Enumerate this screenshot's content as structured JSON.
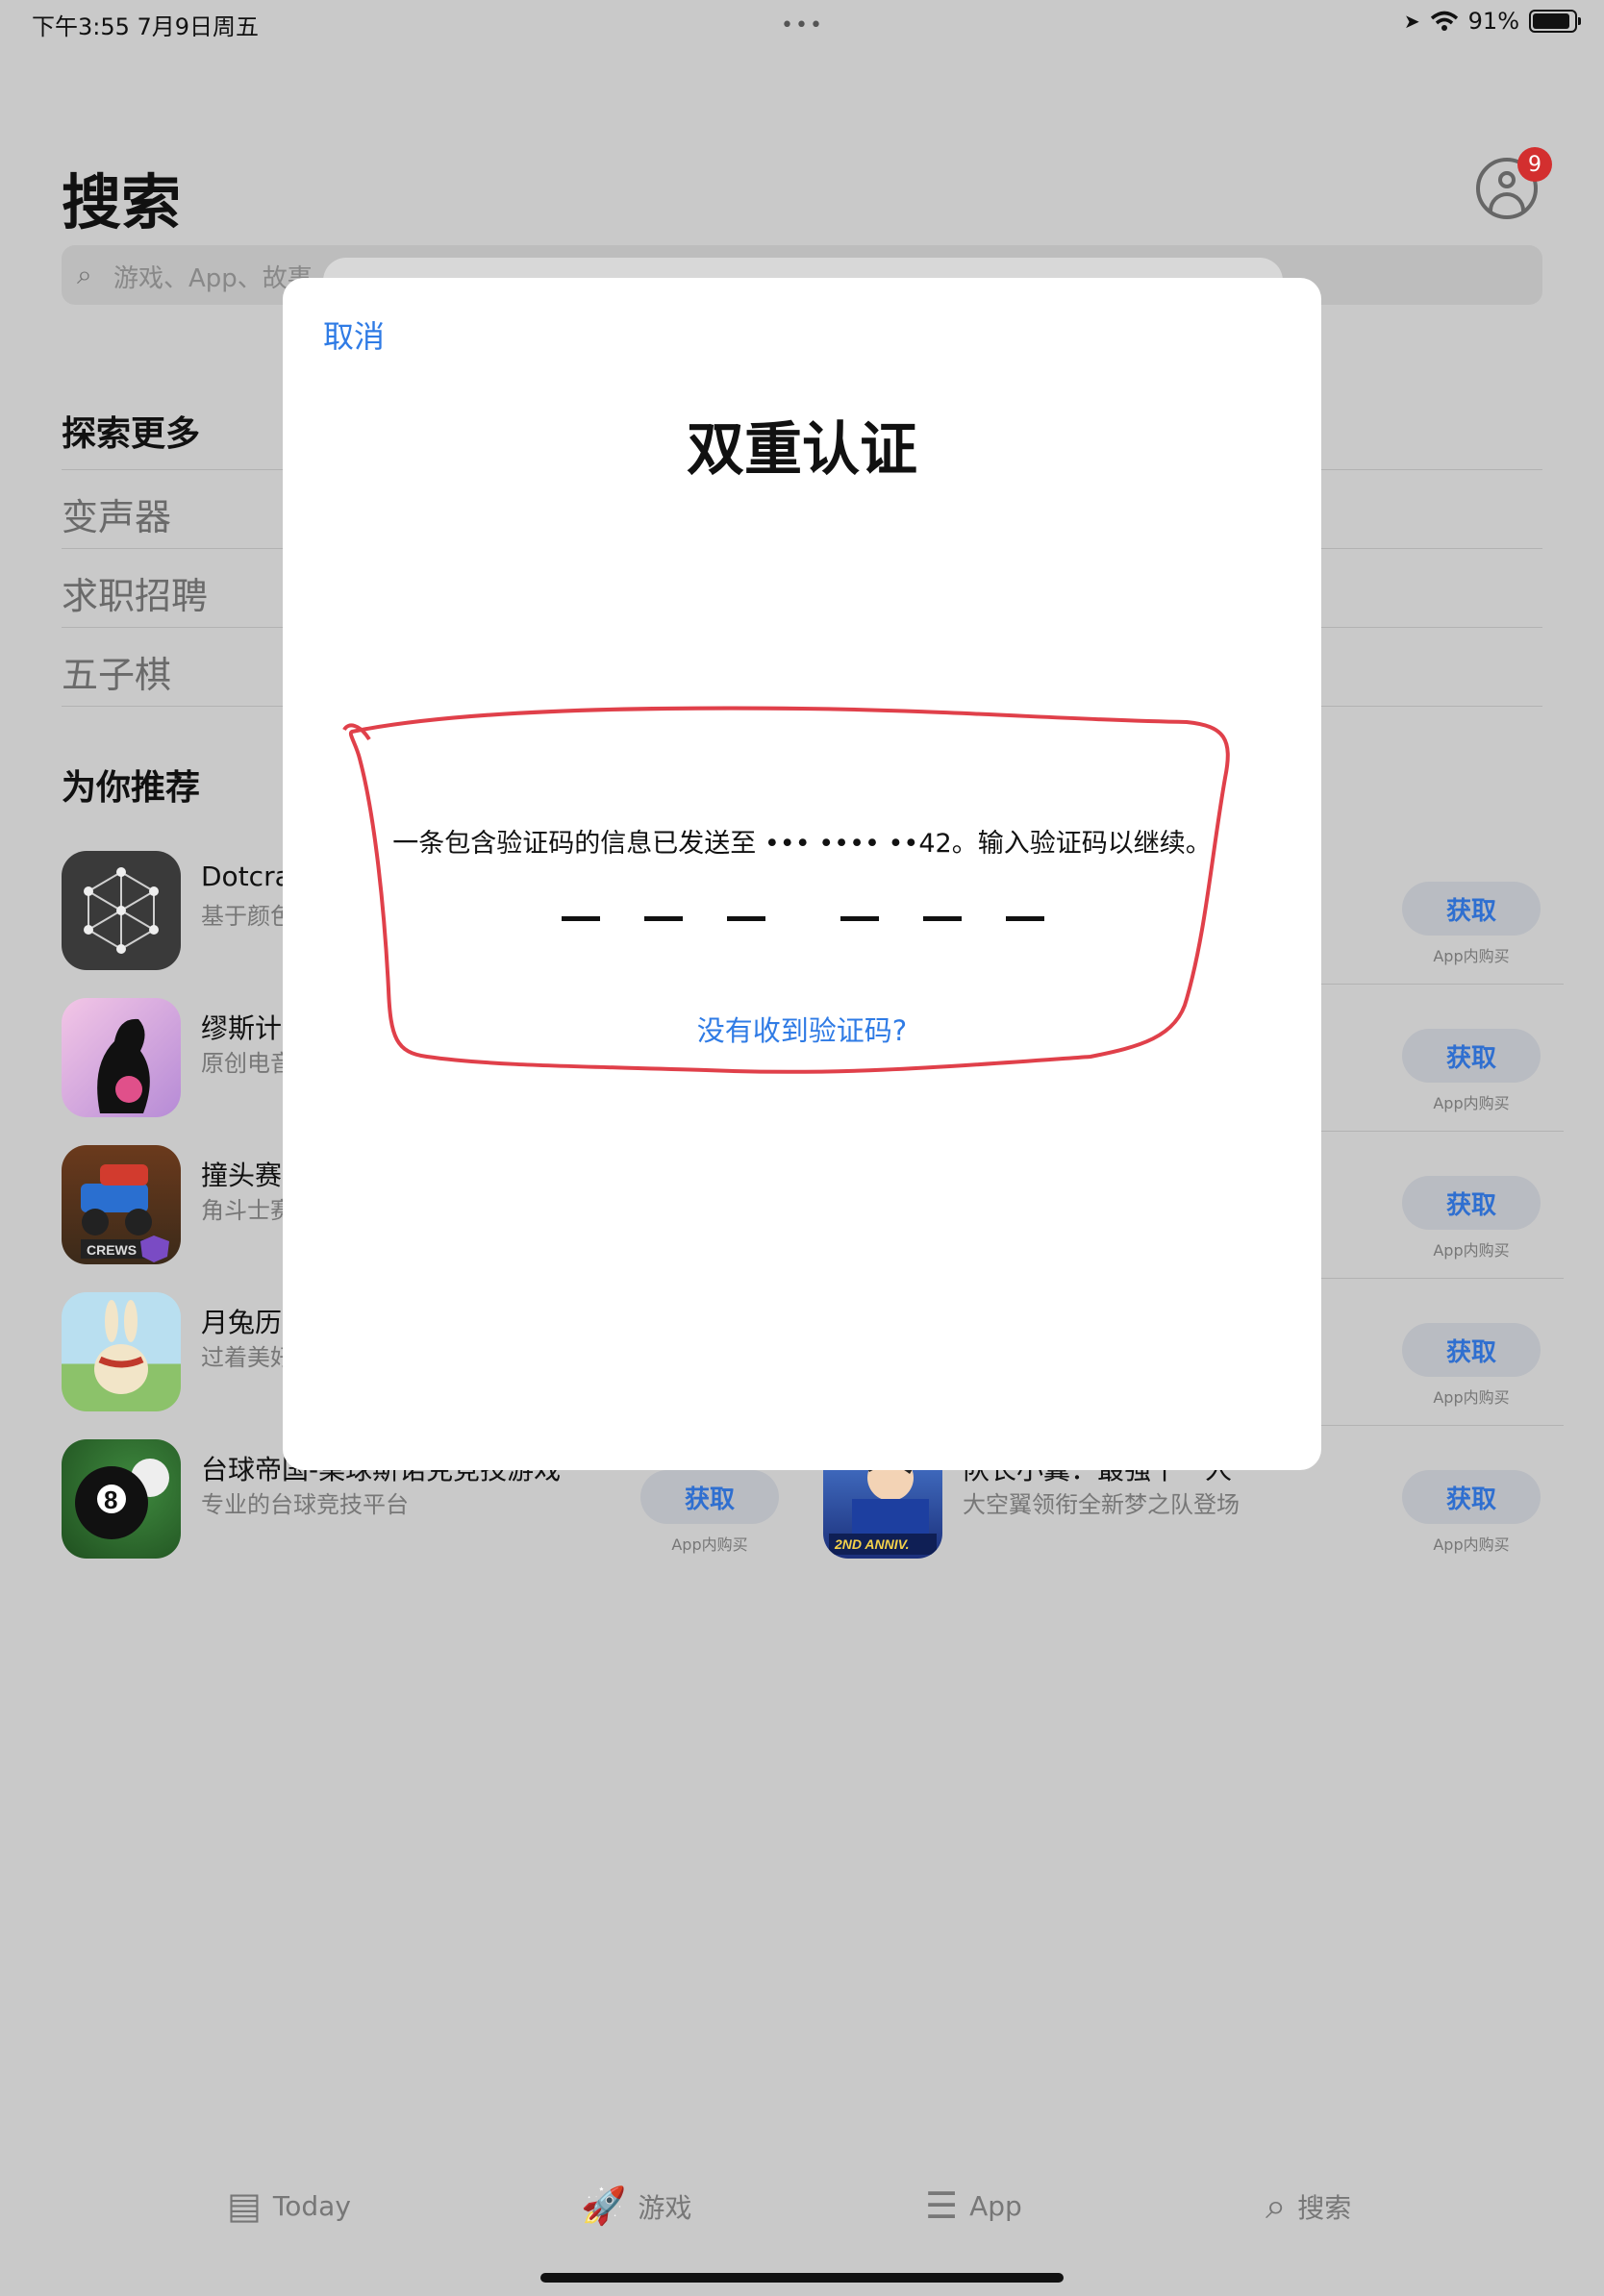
{
  "status_bar": {
    "time": "下午3:55   7月9日周五",
    "dots": "•••",
    "battery_text": "91%",
    "battery_level": 0.91
  },
  "header": {
    "title": "搜索",
    "badge": "9",
    "search_placeholder": "游戏、App、故事"
  },
  "explore": {
    "heading": "探索更多",
    "items": [
      "变声器",
      "求职招聘",
      "五子棋"
    ]
  },
  "recommend": {
    "heading": "为你推荐",
    "get_label": "获取",
    "iap_label": "App内购买",
    "left_apps": [
      {
        "name": "Dotcra",
        "sub": "基于颜色 (Color-B"
      },
      {
        "name": "缪斯计",
        "sub": "原创电音"
      },
      {
        "name": "撞头赛",
        "sub": "角斗士赛"
      },
      {
        "name": "月兔历",
        "sub": "过着美好"
      },
      {
        "name": "台球帝国-桌球斯诺克竞技游戏",
        "sub": "专业的台球竞技平台"
      }
    ],
    "right_apps": [
      {
        "name": "",
        "sub": ""
      },
      {
        "name": "",
        "sub": ""
      },
      {
        "name": "",
        "sub": ""
      },
      {
        "name": "",
        "sub": ""
      },
      {
        "name": "队长小翼：最强十一人",
        "sub": "大空翼领衔全新梦之队登场"
      }
    ],
    "icon_texts": {
      "crews": "CREWS",
      "anniv": "2ND ANNIV."
    }
  },
  "tabbar": {
    "tabs": [
      {
        "label": "Today",
        "icon": "today-icon"
      },
      {
        "label": "游戏",
        "icon": "rocket-icon"
      },
      {
        "label": "App",
        "icon": "layers-icon"
      },
      {
        "label": "搜索",
        "icon": "search-icon"
      }
    ]
  },
  "modal": {
    "cancel": "取消",
    "title": "双重认证",
    "message": "一条包含验证码的信息已发送至 ••• •••• ••42。输入验证码以继续。",
    "resend": "没有收到验证码?",
    "code_digits": 6
  },
  "colors": {
    "accent": "#2f7be5",
    "badge": "#d32f2f",
    "scribble": "#e0404a"
  }
}
